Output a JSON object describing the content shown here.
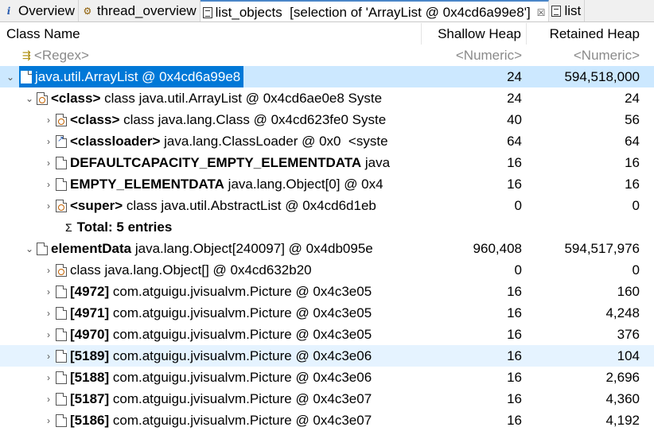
{
  "tabs": [
    {
      "label": "Overview",
      "icon": "info-icon",
      "active": false
    },
    {
      "label": "thread_overview",
      "icon": "gear-icon",
      "active": false
    },
    {
      "label": "list_objects  [selection of 'ArrayList @ 0x4cd6a99e8']",
      "icon": "document-icon",
      "active": true,
      "close": "☒"
    },
    {
      "label": "list",
      "icon": "document-icon",
      "active": false
    }
  ],
  "columns": {
    "name": "Class Name",
    "shallow": "Shallow Heap",
    "retained": "Retained Heap"
  },
  "filter": {
    "name": "<Regex>",
    "shallow": "<Numeric>",
    "retained": "<Numeric>"
  },
  "rows": [
    {
      "bold": "",
      "text": "java.util.ArrayList @ 0x4cd6a99e8",
      "shallow": "24",
      "retained": "594,518,000"
    },
    {
      "bold": "<class>",
      "text": " class java.util.ArrayList @ 0x4cd6ae0e8 Syste",
      "shallow": "24",
      "retained": "24"
    },
    {
      "bold": "<class>",
      "text": " class java.lang.Class @ 0x4cd623fe0 Syste",
      "shallow": "40",
      "retained": "56"
    },
    {
      "bold": "<classloader>",
      "text": " java.lang.ClassLoader @ 0x0  <syste",
      "shallow": "64",
      "retained": "64"
    },
    {
      "bold": "DEFAULTCAPACITY_EMPTY_ELEMENTDATA",
      "text": " java",
      "shallow": "16",
      "retained": "16"
    },
    {
      "bold": "EMPTY_ELEMENTDATA",
      "text": " java.lang.Object[0] @ 0x4",
      "shallow": "16",
      "retained": "16"
    },
    {
      "bold": "<super>",
      "text": " class java.util.AbstractList @ 0x4cd6d1eb",
      "shallow": "0",
      "retained": "0"
    },
    {
      "bold": "Total: 5 entries",
      "text": "",
      "shallow": "",
      "retained": ""
    },
    {
      "bold": "elementData",
      "text": " java.lang.Object[240097] @ 0x4db095e",
      "shallow": "960,408",
      "retained": "594,517,976"
    },
    {
      "bold": "",
      "text": "class java.lang.Object[] @ 0x4cd632b20",
      "shallow": "0",
      "retained": "0"
    },
    {
      "bold": "[4972]",
      "text": " com.atguigu.jvisualvm.Picture @ 0x4c3e05",
      "shallow": "16",
      "retained": "160"
    },
    {
      "bold": "[4971]",
      "text": " com.atguigu.jvisualvm.Picture @ 0x4c3e05",
      "shallow": "16",
      "retained": "4,248"
    },
    {
      "bold": "[4970]",
      "text": " com.atguigu.jvisualvm.Picture @ 0x4c3e05",
      "shallow": "16",
      "retained": "376"
    },
    {
      "bold": "[5189]",
      "text": " com.atguigu.jvisualvm.Picture @ 0x4c3e06",
      "shallow": "16",
      "retained": "104"
    },
    {
      "bold": "[5188]",
      "text": " com.atguigu.jvisualvm.Picture @ 0x4c3e06",
      "shallow": "16",
      "retained": "2,696"
    },
    {
      "bold": "[5187]",
      "text": " com.atguigu.jvisualvm.Picture @ 0x4c3e07",
      "shallow": "16",
      "retained": "4,360"
    },
    {
      "bold": "[5186]",
      "text": " com.atguigu.jvisualvm.Picture @ 0x4c3e07",
      "shallow": "16",
      "retained": "4,192"
    }
  ],
  "sigma": "Σ",
  "colors": {
    "selection": "#0078d7",
    "row_highlight": "#cce8ff",
    "placeholder": "#8a8a8a"
  }
}
